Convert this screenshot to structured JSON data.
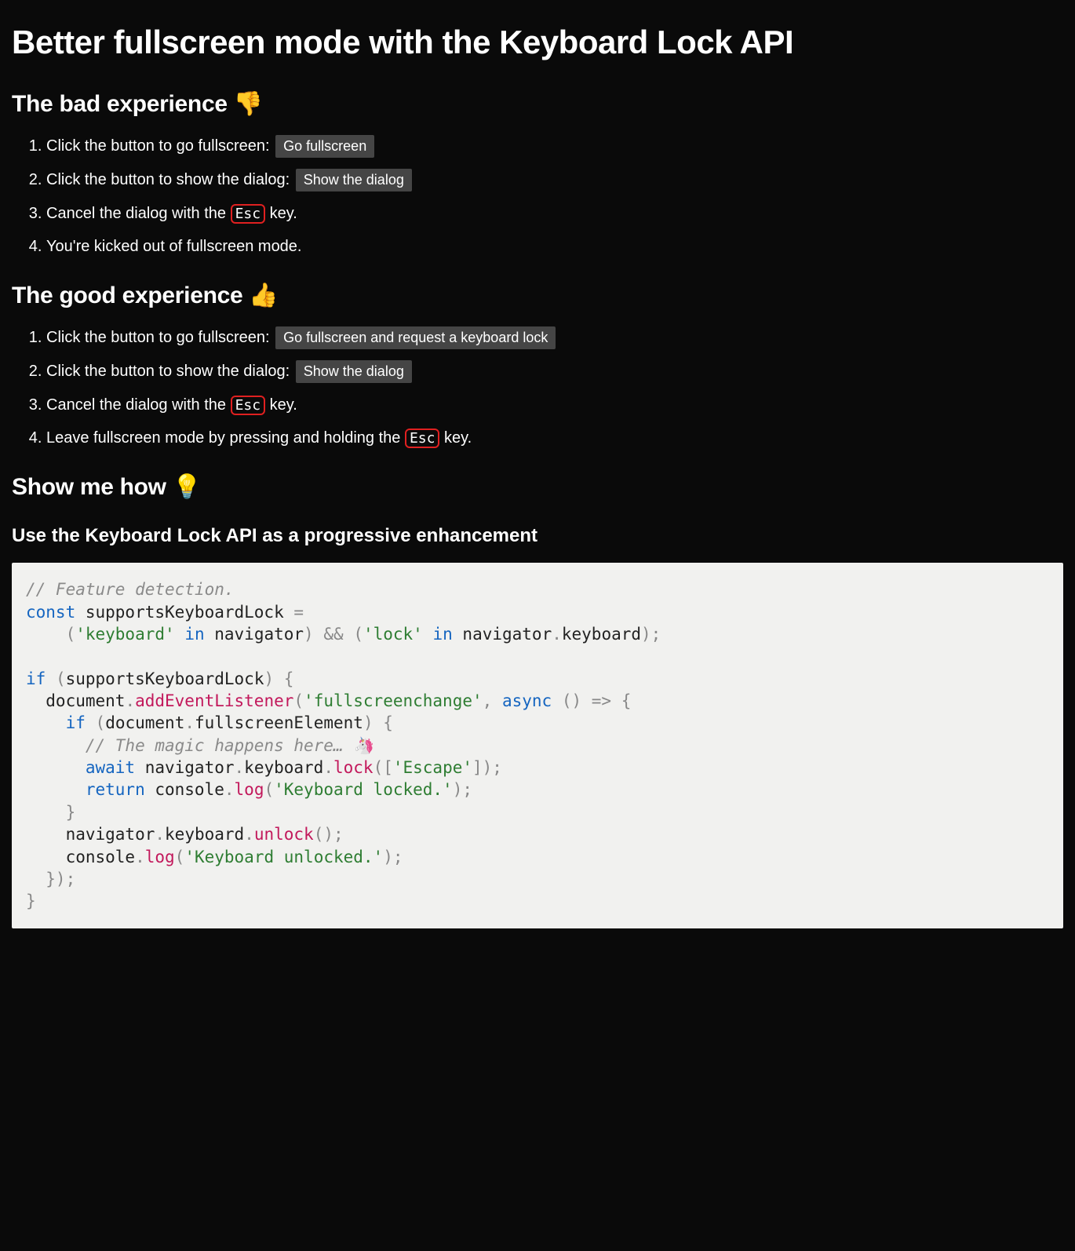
{
  "title": "Better fullscreen mode with the Keyboard Lock API",
  "bad": {
    "heading": "The bad experience 👎",
    "step1_pre": "Click the button to go fullscreen: ",
    "step1_btn": "Go fullscreen",
    "step2_pre": "Click the button to show the dialog: ",
    "step2_btn": "Show the dialog",
    "step3_pre": "Cancel the dialog with the ",
    "step3_key": "Esc",
    "step3_post": " key.",
    "step4": "You're kicked out of fullscreen mode."
  },
  "good": {
    "heading": "The good experience 👍",
    "step1_pre": "Click the button to go fullscreen: ",
    "step1_btn": "Go fullscreen and request a keyboard lock",
    "step2_pre": "Click the button to show the dialog: ",
    "step2_btn": "Show the dialog",
    "step3_pre": "Cancel the dialog with the ",
    "step3_key": "Esc",
    "step3_post": " key.",
    "step4_pre": "Leave fullscreen mode by pressing and holding the ",
    "step4_key": "Esc",
    "step4_post": " key."
  },
  "how": {
    "heading": "Show me how 💡",
    "subheading": "Use the Keyboard Lock API as a progressive enhancement"
  },
  "code": {
    "l1": "// Feature detection.",
    "l2a": "const",
    "l2b": " supportsKeyboardLock ",
    "l2c": "=",
    "l3a": "    (",
    "l3b": "'keyboard'",
    "l3c": " ",
    "l3d": "in",
    "l3e": " navigator",
    "l3f": ")",
    "l3g": " ",
    "l3h": "&&",
    "l3i": " ",
    "l3j": "(",
    "l3k": "'lock'",
    "l3l": " ",
    "l3m": "in",
    "l3n": " navigator",
    "l3o": ".",
    "l3p": "keyboard",
    "l3q": ");",
    "l5a": "if",
    "l5b": " ",
    "l5c": "(",
    "l5d": "supportsKeyboardLock",
    "l5e": ")",
    "l5f": " {",
    "l6a": "  document",
    "l6b": ".",
    "l6c": "addEventListener",
    "l6d": "(",
    "l6e": "'fullscreenchange'",
    "l6f": ",",
    "l6g": " ",
    "l6h": "async",
    "l6i": " ",
    "l6j": "()",
    "l6k": " ",
    "l6l": "=>",
    "l6m": " {",
    "l7a": "    ",
    "l7b": "if",
    "l7c": " ",
    "l7d": "(",
    "l7e": "document",
    "l7f": ".",
    "l7g": "fullscreenElement",
    "l7h": ")",
    "l7i": " {",
    "l8": "      // The magic happens here… 🦄",
    "l9a": "      ",
    "l9b": "await",
    "l9c": " navigator",
    "l9d": ".",
    "l9e": "keyboard",
    "l9f": ".",
    "l9g": "lock",
    "l9h": "([",
    "l9i": "'Escape'",
    "l9j": "]);",
    "l10a": "      ",
    "l10b": "return",
    "l10c": " console",
    "l10d": ".",
    "l10e": "log",
    "l10f": "(",
    "l10g": "'Keyboard locked.'",
    "l10h": ");",
    "l11": "    }",
    "l12a": "    navigator",
    "l12b": ".",
    "l12c": "keyboard",
    "l12d": ".",
    "l12e": "unlock",
    "l12f": "();",
    "l13a": "    console",
    "l13b": ".",
    "l13c": "log",
    "l13d": "(",
    "l13e": "'Keyboard unlocked.'",
    "l13f": ");",
    "l14": "  });",
    "l15": "}"
  }
}
